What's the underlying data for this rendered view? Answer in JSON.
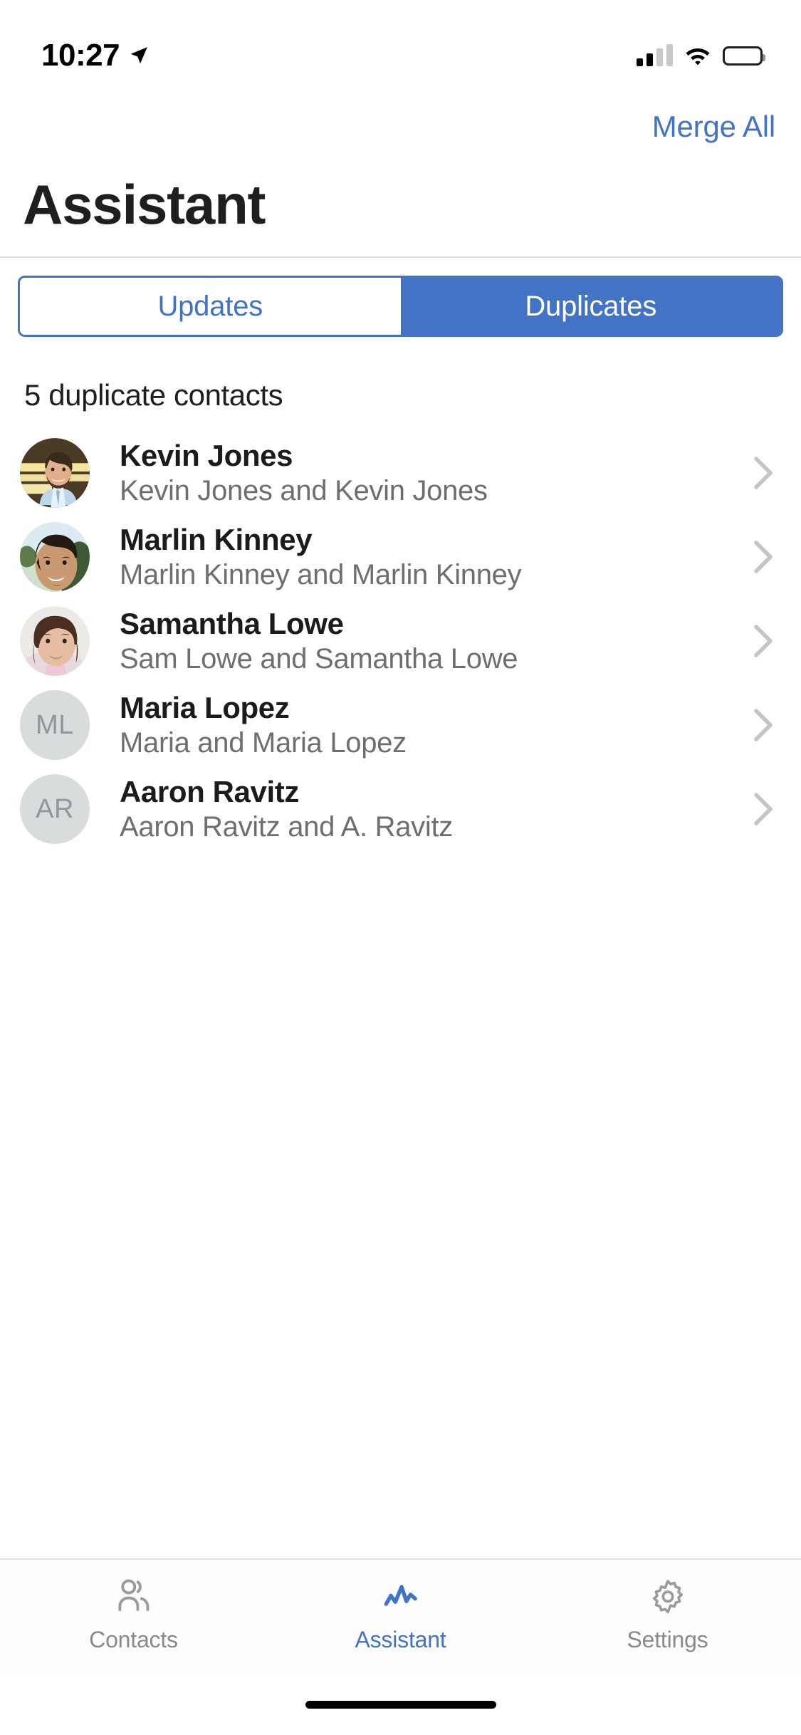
{
  "status_bar": {
    "time": "10:27",
    "location_icon": "location-arrow-icon",
    "signal_icon": "cellular-signal-icon",
    "wifi_icon": "wifi-icon",
    "battery_icon": "battery-full-icon"
  },
  "nav": {
    "merge_all_label": "Merge All",
    "title": "Assistant"
  },
  "segmented_control": {
    "options": [
      {
        "label": "Updates",
        "active": false
      },
      {
        "label": "Duplicates",
        "active": true
      }
    ]
  },
  "list": {
    "header": "5 duplicate contacts",
    "rows": [
      {
        "name": "Kevin Jones",
        "subtitle": "Kevin Jones and Kevin Jones",
        "avatar_type": "photo",
        "avatar_name": "avatar-photo-kevin-jones",
        "initials": ""
      },
      {
        "name": "Marlin Kinney",
        "subtitle": "Marlin Kinney and Marlin Kinney",
        "avatar_type": "photo",
        "avatar_name": "avatar-photo-marlin-kinney",
        "initials": ""
      },
      {
        "name": "Samantha Lowe",
        "subtitle": "Sam Lowe and Samantha Lowe",
        "avatar_type": "photo",
        "avatar_name": "avatar-photo-samantha-lowe",
        "initials": ""
      },
      {
        "name": "Maria Lopez",
        "subtitle": "Maria and Maria Lopez",
        "avatar_type": "initials",
        "avatar_name": "avatar-initials-maria-lopez",
        "initials": "ML"
      },
      {
        "name": "Aaron Ravitz",
        "subtitle": "Aaron Ravitz and A. Ravitz",
        "avatar_type": "initials",
        "avatar_name": "avatar-initials-aaron-ravitz",
        "initials": "AR"
      }
    ],
    "chevron_icon": "chevron-right-icon"
  },
  "tabbar": {
    "tabs": [
      {
        "label": "Contacts",
        "icon": "people-icon",
        "active": false
      },
      {
        "label": "Assistant",
        "icon": "pulse-icon",
        "active": true
      },
      {
        "label": "Settings",
        "icon": "gear-icon",
        "active": false
      }
    ]
  },
  "colors": {
    "accent": "#4373c4",
    "title": "#1f1f1f",
    "subtitle": "#6e6e6e",
    "chevron": "#c4c4c4",
    "avatar_placeholder_bg": "#d9dcdd",
    "avatar_placeholder_text": "#8e979b",
    "tab_inactive": "#8a8a8a"
  }
}
